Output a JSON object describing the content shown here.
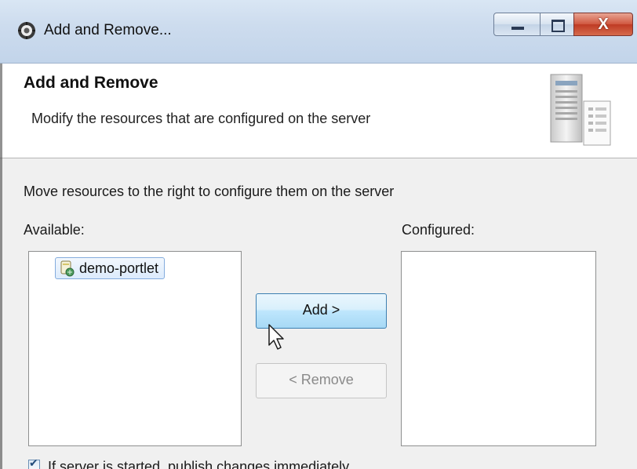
{
  "window": {
    "title": "Add and Remove...",
    "close_glyph": "X"
  },
  "header": {
    "title": "Add and Remove",
    "description": "Modify the resources that are configured on the server"
  },
  "body": {
    "instruction": "Move resources to the right to configure them on the server",
    "available_label": "Available:",
    "configured_label": "Configured:",
    "available_items": [
      {
        "label": "demo-portlet",
        "icon": "web-project-icon",
        "selected": true
      }
    ],
    "configured_items": [],
    "add_button": "Add >",
    "remove_button": "< Remove",
    "remove_enabled": false,
    "checkbox": {
      "label": "If server is started, publish changes immediately",
      "checked": true
    }
  },
  "colors": {
    "titlebar": "#cddcee",
    "close_button": "#c94a33",
    "selection_border": "#84acdd",
    "primary_button_border": "#3c7fb1"
  }
}
